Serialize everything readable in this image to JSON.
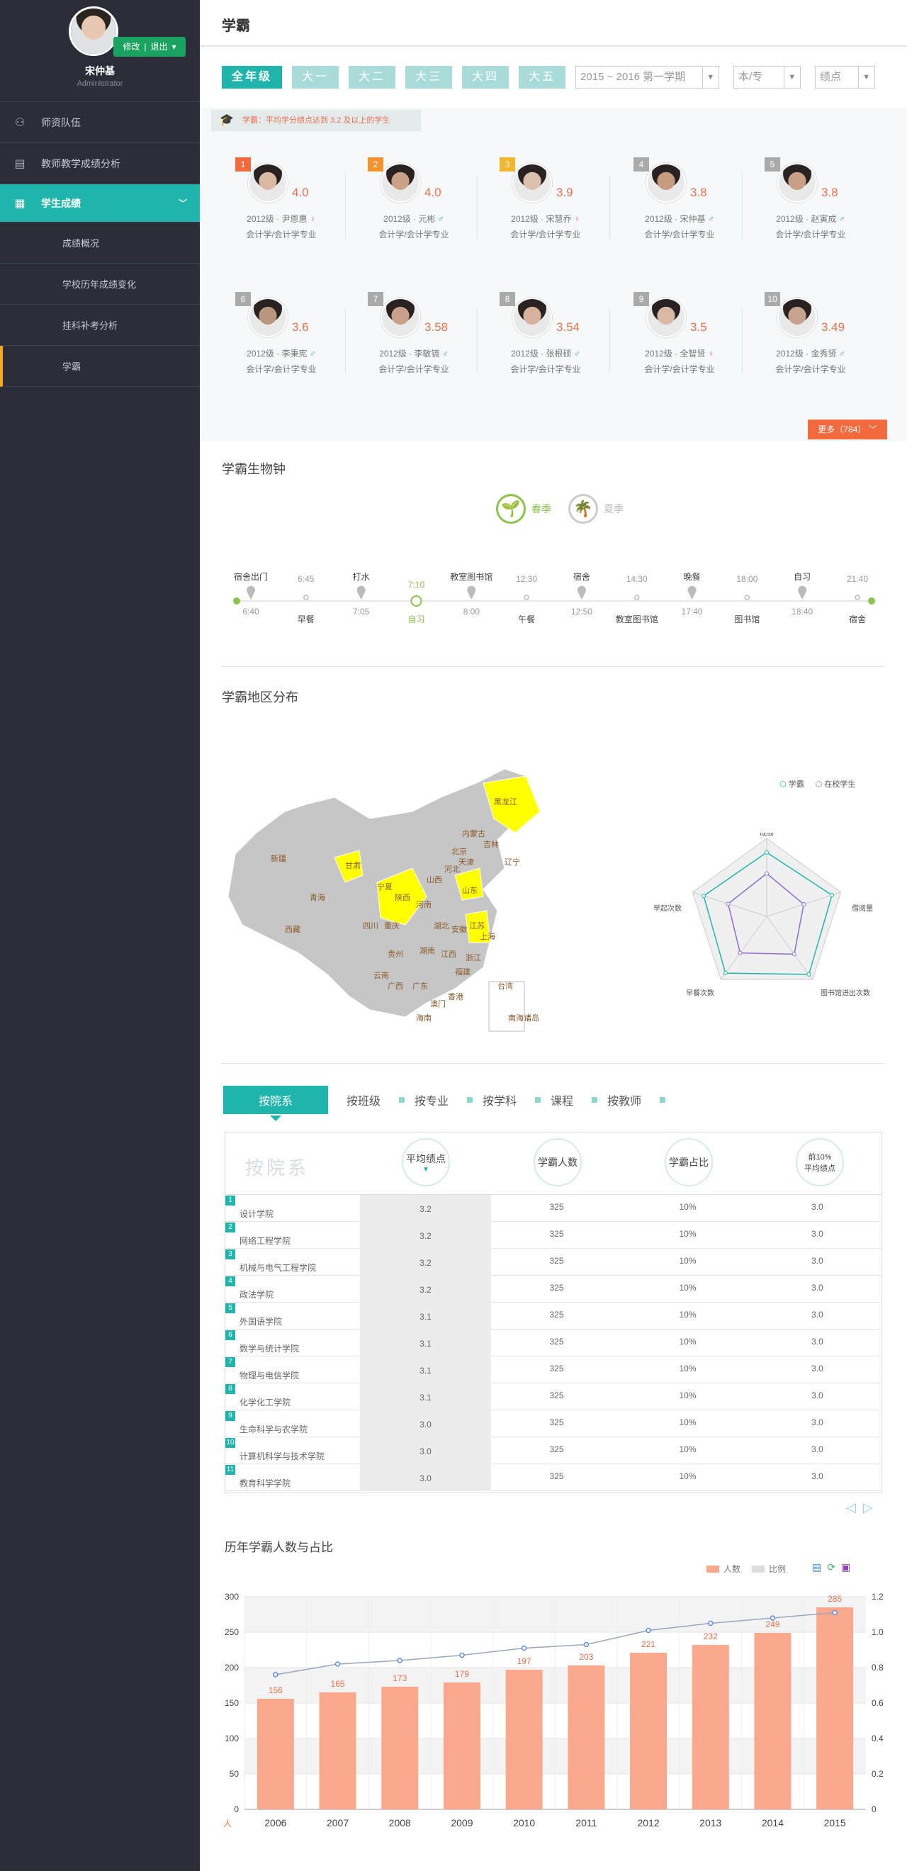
{
  "user": {
    "name": "宋仲基",
    "role": "Administrator",
    "edit": "修改",
    "logout": "退出"
  },
  "nav": [
    {
      "label": "师资队伍",
      "icon": "user-group-icon"
    },
    {
      "label": "教师教学成绩分析",
      "icon": "book-icon"
    },
    {
      "label": "学生成绩",
      "icon": "clipboard-icon"
    }
  ],
  "subnav": [
    "成绩概况",
    "学校历年成绩变化",
    "挂科补考分析",
    "学霸"
  ],
  "page": {
    "title": "学霸"
  },
  "filters": {
    "grades": [
      "全年级",
      "大一",
      "大二",
      "大三",
      "大四",
      "大五"
    ],
    "term": "2015 ~ 2016 第一学期",
    "level": "本/专",
    "metric": "绩点"
  },
  "hint": "学霸：平均学分绩点达到 3.2 及以上的学生",
  "students": [
    {
      "rank": "1",
      "gpa": "4.0",
      "info": "2012级 · 尹恩惠",
      "gender": "♀",
      "major": "会计学/会计学专业",
      "rank_color": "#f26a3d"
    },
    {
      "rank": "2",
      "gpa": "4.0",
      "info": "2012级 · 元彬",
      "gender": "♂",
      "major": "会计学/会计学专业",
      "rank_color": "#f5922d"
    },
    {
      "rank": "3",
      "gpa": "3.9",
      "info": "2012级 · 宋慧乔",
      "gender": "♀",
      "major": "会计学/会计学专业",
      "rank_color": "#f5b62d"
    },
    {
      "rank": "4",
      "gpa": "3.8",
      "info": "2012级 · 宋仲基",
      "gender": "♂",
      "major": "会计学/会计学专业",
      "rank_color": "#aaaaaa"
    },
    {
      "rank": "5",
      "gpa": "3.8",
      "info": "2012级 · 赵寅成",
      "gender": "♂",
      "major": "会计学/会计学专业",
      "rank_color": "#aaaaaa"
    },
    {
      "rank": "6",
      "gpa": "3.6",
      "info": "2012级 · 李秉宪",
      "gender": "♂",
      "major": "会计学/会计学专业",
      "rank_color": "#aaaaaa"
    },
    {
      "rank": "7",
      "gpa": "3.58",
      "info": "2012级 · 李敏镐",
      "gender": "♂",
      "major": "会计学/会计学专业",
      "rank_color": "#aaaaaa"
    },
    {
      "rank": "8",
      "gpa": "3.54",
      "info": "2012级 · 张根硕",
      "gender": "♂",
      "major": "会计学/会计学专业",
      "rank_color": "#aaaaaa"
    },
    {
      "rank": "9",
      "gpa": "3.5",
      "info": "2012级 · 全智贤",
      "gender": "♀",
      "major": "会计学/会计学专业",
      "rank_color": "#aaaaaa"
    },
    {
      "rank": "10",
      "gpa": "3.49",
      "info": "2012级 · 金秀贤",
      "gender": "♂",
      "major": "会计学/会计学专业",
      "rank_color": "#aaaaaa"
    }
  ],
  "more": "更多（784）",
  "clock": {
    "title": "学霸生物钟",
    "spring": "春季",
    "summer": "夏季",
    "top": [
      {
        "label": "宿舍出门",
        "time": ""
      },
      {
        "label": "",
        "time": "6:45"
      },
      {
        "label": "打水",
        "time": ""
      },
      {
        "label": "",
        "time": "7:10"
      },
      {
        "label": "教室图书馆",
        "time": ""
      },
      {
        "label": "",
        "time": "12:30"
      },
      {
        "label": "宿舍",
        "time": ""
      },
      {
        "label": "",
        "time": "14:30"
      },
      {
        "label": "晚餐",
        "time": ""
      },
      {
        "label": "",
        "time": "18:00"
      },
      {
        "label": "自习",
        "time": ""
      },
      {
        "label": "",
        "time": "21:40"
      }
    ],
    "bottom": [
      {
        "label": "",
        "time": "6:40"
      },
      {
        "label": "早餐",
        "time": ""
      },
      {
        "label": "",
        "time": "7:05"
      },
      {
        "label": "自习",
        "time": ""
      },
      {
        "label": "",
        "time": "8:00"
      },
      {
        "label": "午餐",
        "time": ""
      },
      {
        "label": "",
        "time": "12:50"
      },
      {
        "label": "教室图书馆",
        "time": ""
      },
      {
        "label": "",
        "time": "17:40"
      },
      {
        "label": "图书馆",
        "time": ""
      },
      {
        "label": "",
        "time": "18:40"
      },
      {
        "label": "宿舍",
        "time": ""
      }
    ]
  },
  "region": {
    "title": "学霸地区分布",
    "legend": [
      "学霸",
      "在校学生"
    ],
    "provinces": [
      "黑龙江",
      "吉林",
      "辽宁",
      "内蒙古",
      "新疆",
      "甘肃",
      "青海",
      "西藏",
      "宁夏",
      "陕西",
      "山西",
      "河北",
      "北京",
      "天津",
      "山东",
      "河南",
      "江苏",
      "安徽",
      "上海",
      "湖北",
      "四川",
      "重庆",
      "贵州",
      "湖南",
      "江西",
      "浙江",
      "福建",
      "云南",
      "广西",
      "广东",
      "台湾",
      "香港",
      "澳门",
      "海南",
      "南海诸岛"
    ],
    "radar": [
      "成绩",
      "借阅量",
      "图书馆进出次数",
      "早餐次数",
      "早起次数"
    ]
  },
  "tabs": [
    "按院系",
    "按班级",
    "按专业",
    "按学科",
    "课程",
    "按教师"
  ],
  "table": {
    "big": "按院系",
    "headers": [
      "平均绩点",
      "学霸人数",
      "学霸占比",
      "前10%平均绩点"
    ],
    "rows": [
      {
        "n": "1",
        "name": "设计学院",
        "a": "3.2",
        "b": "325",
        "c": "10%",
        "d": "3.0"
      },
      {
        "n": "2",
        "name": "网络工程学院",
        "a": "3.2",
        "b": "325",
        "c": "10%",
        "d": "3.0"
      },
      {
        "n": "3",
        "name": "机械与电气工程学院",
        "a": "3.2",
        "b": "325",
        "c": "10%",
        "d": "3.0"
      },
      {
        "n": "4",
        "name": "政法学院",
        "a": "3.2",
        "b": "325",
        "c": "10%",
        "d": "3.0"
      },
      {
        "n": "5",
        "name": "外国语学院",
        "a": "3.1",
        "b": "325",
        "c": "10%",
        "d": "3.0"
      },
      {
        "n": "6",
        "name": "数学与统计学院",
        "a": "3.1",
        "b": "325",
        "c": "10%",
        "d": "3.0"
      },
      {
        "n": "7",
        "name": "物理与电信学院",
        "a": "3.1",
        "b": "325",
        "c": "10%",
        "d": "3.0"
      },
      {
        "n": "8",
        "name": "化学化工学院",
        "a": "3.1",
        "b": "325",
        "c": "10%",
        "d": "3.0"
      },
      {
        "n": "9",
        "name": "生命科学与农学院",
        "a": "3.0",
        "b": "325",
        "c": "10%",
        "d": "3.0"
      },
      {
        "n": "10",
        "name": "计算机科学与技术学院",
        "a": "3.0",
        "b": "325",
        "c": "10%",
        "d": "3.0"
      },
      {
        "n": "11",
        "name": "教育科学学院",
        "a": "3.0",
        "b": "325",
        "c": "10%",
        "d": "3.0"
      }
    ]
  },
  "chart_data": {
    "type": "bar",
    "title": "历年学霸人数与占比",
    "categories": [
      "2006",
      "2007",
      "2008",
      "2009",
      "2010",
      "2011",
      "2012",
      "2013",
      "2014",
      "2015"
    ],
    "series": [
      {
        "name": "人数",
        "values": [
          156,
          165,
          173,
          179,
          197,
          203,
          221,
          232,
          249,
          285
        ]
      },
      {
        "name": "比例",
        "values": [
          0.76,
          0.82,
          0.84,
          0.87,
          0.91,
          0.93,
          1.01,
          1.05,
          1.08,
          1.11
        ]
      }
    ],
    "ylim": [
      0,
      300
    ],
    "y2lim": [
      0,
      1.2
    ],
    "yticks": [
      "0",
      "50",
      "100",
      "150",
      "200",
      "250",
      "300"
    ],
    "y2ticks": [
      "0",
      "0.2",
      "0.4",
      "0.6",
      "0.8",
      "1.0",
      "1.2"
    ],
    "ylabel": "人",
    "bar_color": "#fba98c",
    "line_color": "#9aa6be"
  }
}
